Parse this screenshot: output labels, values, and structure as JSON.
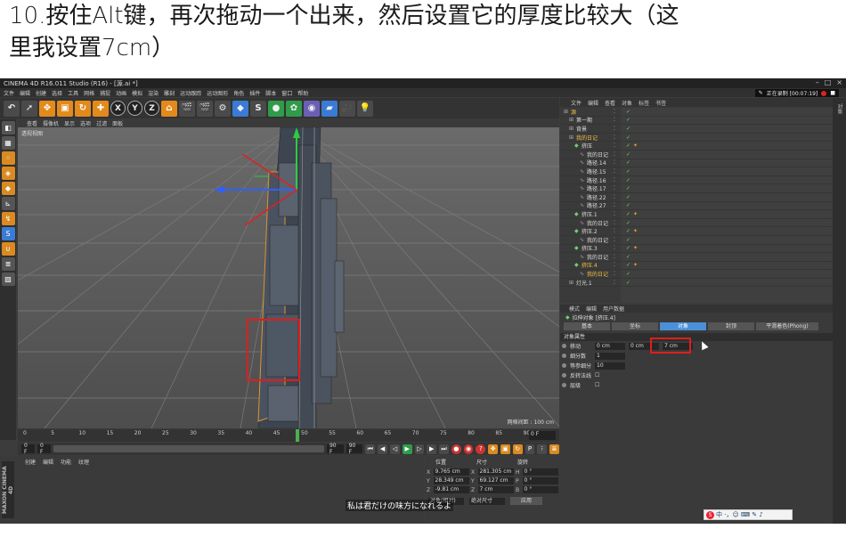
{
  "tutorial": {
    "line1": "10.按住Alt键，再次拖动一个出来，然后设置它的厚度比较大（这",
    "line2": "里我设置7cm）"
  },
  "app": {
    "window_title": "CINEMA 4D R16.011 Studio (R16) - [源.ai *]",
    "menu": [
      "文件",
      "编辑",
      "创建",
      "选择",
      "工具",
      "网格",
      "捕捉",
      "动画",
      "模拟",
      "渲染",
      "雕刻",
      "运动跟踪",
      "运动图形",
      "角色",
      "插件",
      "脚本",
      "窗口",
      "帮助"
    ],
    "recording_label": "正在录制 [00:07:19]"
  },
  "toolbar": {
    "axis_labels": [
      "X",
      "Y",
      "Z"
    ]
  },
  "viewport": {
    "menu": [
      "查看",
      "摄像机",
      "显示",
      "选项",
      "过滤",
      "面板"
    ],
    "label": "透视视图",
    "grid_info": "网格间距 : 100 cm"
  },
  "timeline": {
    "ticks": [
      "0",
      "5",
      "10",
      "15",
      "20",
      "25",
      "30",
      "35",
      "40",
      "45",
      "50",
      "55",
      "60",
      "65",
      "70",
      "75",
      "80",
      "85",
      "90"
    ],
    "current_frame": "0 F",
    "start": "0 F",
    "slider_start": "0 F",
    "slider_end": "90 F",
    "end": "90 F"
  },
  "material": {
    "menu": [
      "创建",
      "编辑",
      "功能",
      "纹理"
    ],
    "brand": "MAXON CINEMA 4D"
  },
  "coords": {
    "headers": [
      "位置",
      "尺寸",
      "旋转"
    ],
    "rows": [
      {
        "axis": "X",
        "pos": "9.765 cm",
        "size": "281.305 cm",
        "rot_axis": "H",
        "rot": "0 °"
      },
      {
        "axis": "Y",
        "pos": "28.349 cm",
        "size": "69.127 cm",
        "rot_axis": "P",
        "rot": "0 °"
      },
      {
        "axis": "Z",
        "pos": "-9.81 cm",
        "size": "7 cm",
        "rot_axis": "B",
        "rot": "0 °"
      }
    ],
    "mode_select": "对象(相对)",
    "size_select": "绝对尺寸",
    "apply": "应用"
  },
  "objects": {
    "menu": [
      "文件",
      "编辑",
      "查看",
      "对象",
      "标签",
      "书签"
    ],
    "rows": [
      {
        "indent": 0,
        "name": "源",
        "hl": true,
        "tag": false
      },
      {
        "indent": 1,
        "name": "第一期",
        "hl": false,
        "tag": false
      },
      {
        "indent": 1,
        "name": "背景",
        "hl": false,
        "tag": false
      },
      {
        "indent": 1,
        "name": "我的日记",
        "hl": true,
        "tag": false
      },
      {
        "indent": 2,
        "name": "挤压",
        "hl": false,
        "tag": true
      },
      {
        "indent": 3,
        "name": "我的日记",
        "hl": false,
        "tag": false
      },
      {
        "indent": 3,
        "name": "路径.14",
        "hl": false,
        "tag": false
      },
      {
        "indent": 3,
        "name": "路径.15",
        "hl": false,
        "tag": false
      },
      {
        "indent": 3,
        "name": "路径.16",
        "hl": false,
        "tag": false
      },
      {
        "indent": 3,
        "name": "路径.17",
        "hl": false,
        "tag": false
      },
      {
        "indent": 3,
        "name": "路径.22",
        "hl": false,
        "tag": false
      },
      {
        "indent": 3,
        "name": "路径.27",
        "hl": false,
        "tag": false
      },
      {
        "indent": 2,
        "name": "挤压.1",
        "hl": false,
        "tag": true
      },
      {
        "indent": 3,
        "name": "我的日记",
        "hl": false,
        "tag": false
      },
      {
        "indent": 2,
        "name": "挤压.2",
        "hl": false,
        "tag": true
      },
      {
        "indent": 3,
        "name": "我的日记",
        "hl": false,
        "tag": false
      },
      {
        "indent": 2,
        "name": "挤压.3",
        "hl": false,
        "tag": true
      },
      {
        "indent": 3,
        "name": "我的日记",
        "hl": false,
        "tag": false
      },
      {
        "indent": 2,
        "name": "挤压.4",
        "hl": true,
        "tag": true
      },
      {
        "indent": 3,
        "name": "我的日记",
        "hl": true,
        "tag": false
      },
      {
        "indent": 1,
        "name": "灯光.1",
        "hl": false,
        "tag": false
      }
    ]
  },
  "attributes": {
    "menu": [
      "模式",
      "编辑",
      "用户数据"
    ],
    "object_name": "拉伸对象 [挤压.4]",
    "tabs": [
      "基本",
      "坐标",
      "对象",
      "封顶",
      "平滑着色(Phong)"
    ],
    "active_tab": 2,
    "section": "对象属性",
    "move_label": "移动",
    "move_values": [
      "0 cm",
      "0 cm",
      "7 cm"
    ],
    "subdivision_label": "细分数",
    "subdivision_value": "1",
    "iso_label": "等参细分",
    "iso_value": "10",
    "flip_normals_label": "反转法线",
    "hierarchy_label": "层级"
  },
  "overlay": {
    "subtitle": "私は君だけの味方になれるよ",
    "ime_logo": "S",
    "ime_text": "中 ·，☺ ⌨ ✎ ♪"
  },
  "colors": {
    "accent_orange": "#e38a1c",
    "active_tab": "#4a8fd8",
    "highlight_red": "#e01d1d",
    "timeline_green": "#4caf50"
  }
}
